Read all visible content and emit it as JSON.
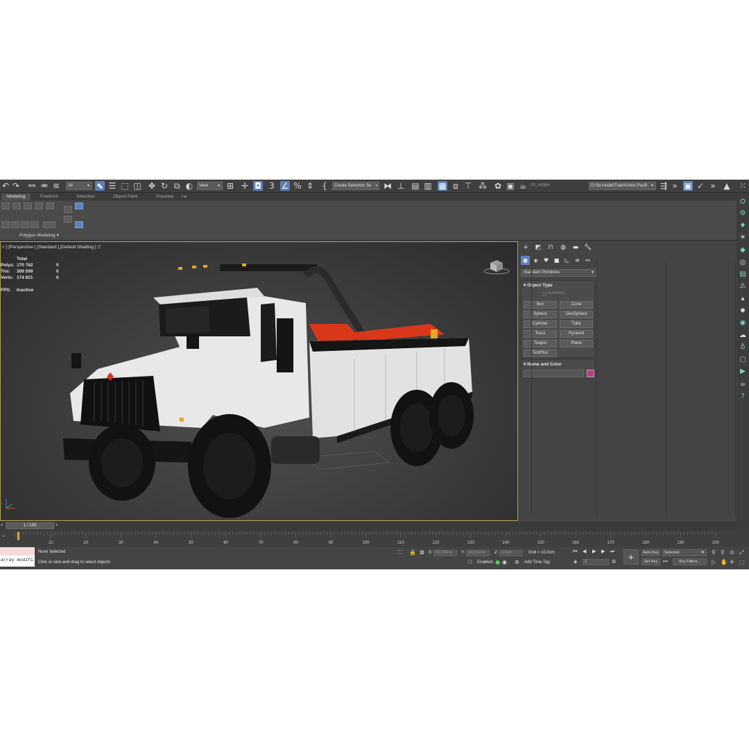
{
  "toolbar": {
    "filter_value": "All",
    "ref_coord_value": "View",
    "selection_set_placeholder": "Create Selection Se",
    "selection_set_arrow": "▾",
    "layer_text": "crt_uvpipe",
    "project_path": "D:\\3d model\\Train\\Union Pacifi",
    "more": "»"
  },
  "ribbon": {
    "tabs": [
      "Modeling",
      "Freeform",
      "Selection",
      "Object Paint",
      "Populate"
    ],
    "active_tab": 0,
    "panel_label": "Polygon Modeling",
    "panel_arrow": "▾"
  },
  "viewport": {
    "label": "+ ] [Perspective ] [Standard ] [Default Shading ]",
    "stats": {
      "header": "Total",
      "rows": [
        {
          "label": "Polys:",
          "total": "170 762",
          "selected": "0"
        },
        {
          "label": "Tris:",
          "total": "309 599",
          "selected": "0"
        },
        {
          "label": "Verts:",
          "total": "174 621",
          "selected": "0"
        }
      ],
      "fps_label": "FPS:",
      "fps_value": "Inactive"
    },
    "colors": {
      "body": "#e8e8e8",
      "crane": "#d8371a",
      "tire": "#151515",
      "frame": "#b5a24a"
    }
  },
  "command_panel": {
    "category": "Standard Primitives",
    "object_type_title": "Object Type",
    "autogrid_label": "AutoGrid",
    "primitives": [
      "Box",
      "Cone",
      "Sphere",
      "GeoSphere",
      "Cylinder",
      "Tube",
      "Torus",
      "Pyramid",
      "Teapot",
      "Plane",
      "TextPlus"
    ],
    "name_color_title": "Name and Color",
    "object_color": "#c23a86"
  },
  "timeline": {
    "frame_display": "1 / 199",
    "prev": "<",
    "next": ">",
    "ticks": [
      "10",
      "20",
      "30",
      "40",
      "50",
      "60",
      "70",
      "80",
      "90",
      "100",
      "110",
      "120",
      "130",
      "140",
      "150",
      "160",
      "170",
      "180",
      "190",
      "200"
    ]
  },
  "status": {
    "maxscript_text": "array modifi",
    "selection_status": "None Selected",
    "prompt": "Click or click-and-drag to select objects",
    "x_label": "X:",
    "x_value": "23,139cm",
    "y_label": "Y:",
    "y_value": "46,616cm",
    "z_label": "Z:",
    "z_value": "0,0cm",
    "grid": "Grid = 10,0cm",
    "enabled_label": "Enabled:",
    "add_time_tag": "Add Time Tag",
    "auto_key": "Auto Key",
    "set_key": "Set Key",
    "key_mode": "Selected",
    "key_filters": "Key Filters...",
    "current_frame": "1"
  }
}
